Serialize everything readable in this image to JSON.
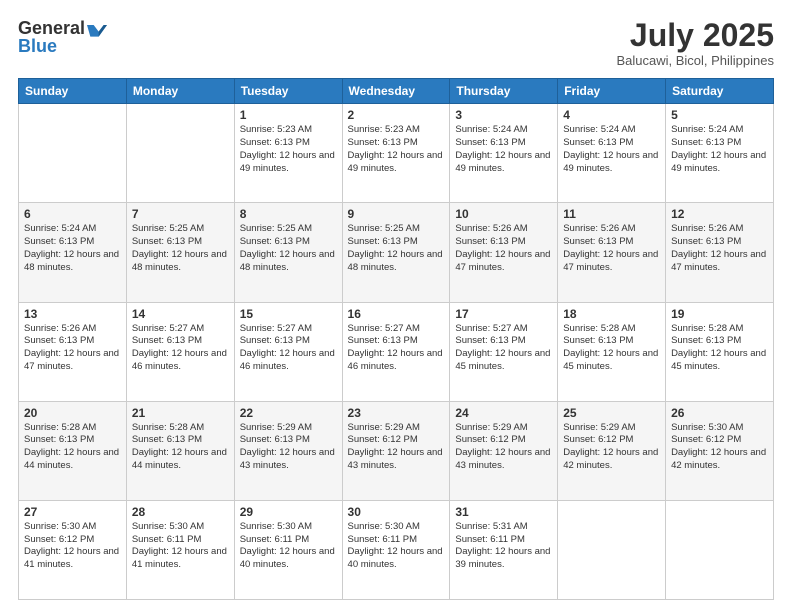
{
  "header": {
    "logo_general": "General",
    "logo_blue": "Blue",
    "month_title": "July 2025",
    "subtitle": "Balucawi, Bicol, Philippines"
  },
  "days_of_week": [
    "Sunday",
    "Monday",
    "Tuesday",
    "Wednesday",
    "Thursday",
    "Friday",
    "Saturday"
  ],
  "weeks": [
    [
      {
        "day": "",
        "info": ""
      },
      {
        "day": "",
        "info": ""
      },
      {
        "day": "1",
        "info": "Sunrise: 5:23 AM\nSunset: 6:13 PM\nDaylight: 12 hours and 49 minutes."
      },
      {
        "day": "2",
        "info": "Sunrise: 5:23 AM\nSunset: 6:13 PM\nDaylight: 12 hours and 49 minutes."
      },
      {
        "day": "3",
        "info": "Sunrise: 5:24 AM\nSunset: 6:13 PM\nDaylight: 12 hours and 49 minutes."
      },
      {
        "day": "4",
        "info": "Sunrise: 5:24 AM\nSunset: 6:13 PM\nDaylight: 12 hours and 49 minutes."
      },
      {
        "day": "5",
        "info": "Sunrise: 5:24 AM\nSunset: 6:13 PM\nDaylight: 12 hours and 49 minutes."
      }
    ],
    [
      {
        "day": "6",
        "info": "Sunrise: 5:24 AM\nSunset: 6:13 PM\nDaylight: 12 hours and 48 minutes."
      },
      {
        "day": "7",
        "info": "Sunrise: 5:25 AM\nSunset: 6:13 PM\nDaylight: 12 hours and 48 minutes."
      },
      {
        "day": "8",
        "info": "Sunrise: 5:25 AM\nSunset: 6:13 PM\nDaylight: 12 hours and 48 minutes."
      },
      {
        "day": "9",
        "info": "Sunrise: 5:25 AM\nSunset: 6:13 PM\nDaylight: 12 hours and 48 minutes."
      },
      {
        "day": "10",
        "info": "Sunrise: 5:26 AM\nSunset: 6:13 PM\nDaylight: 12 hours and 47 minutes."
      },
      {
        "day": "11",
        "info": "Sunrise: 5:26 AM\nSunset: 6:13 PM\nDaylight: 12 hours and 47 minutes."
      },
      {
        "day": "12",
        "info": "Sunrise: 5:26 AM\nSunset: 6:13 PM\nDaylight: 12 hours and 47 minutes."
      }
    ],
    [
      {
        "day": "13",
        "info": "Sunrise: 5:26 AM\nSunset: 6:13 PM\nDaylight: 12 hours and 47 minutes."
      },
      {
        "day": "14",
        "info": "Sunrise: 5:27 AM\nSunset: 6:13 PM\nDaylight: 12 hours and 46 minutes."
      },
      {
        "day": "15",
        "info": "Sunrise: 5:27 AM\nSunset: 6:13 PM\nDaylight: 12 hours and 46 minutes."
      },
      {
        "day": "16",
        "info": "Sunrise: 5:27 AM\nSunset: 6:13 PM\nDaylight: 12 hours and 46 minutes."
      },
      {
        "day": "17",
        "info": "Sunrise: 5:27 AM\nSunset: 6:13 PM\nDaylight: 12 hours and 45 minutes."
      },
      {
        "day": "18",
        "info": "Sunrise: 5:28 AM\nSunset: 6:13 PM\nDaylight: 12 hours and 45 minutes."
      },
      {
        "day": "19",
        "info": "Sunrise: 5:28 AM\nSunset: 6:13 PM\nDaylight: 12 hours and 45 minutes."
      }
    ],
    [
      {
        "day": "20",
        "info": "Sunrise: 5:28 AM\nSunset: 6:13 PM\nDaylight: 12 hours and 44 minutes."
      },
      {
        "day": "21",
        "info": "Sunrise: 5:28 AM\nSunset: 6:13 PM\nDaylight: 12 hours and 44 minutes."
      },
      {
        "day": "22",
        "info": "Sunrise: 5:29 AM\nSunset: 6:13 PM\nDaylight: 12 hours and 43 minutes."
      },
      {
        "day": "23",
        "info": "Sunrise: 5:29 AM\nSunset: 6:12 PM\nDaylight: 12 hours and 43 minutes."
      },
      {
        "day": "24",
        "info": "Sunrise: 5:29 AM\nSunset: 6:12 PM\nDaylight: 12 hours and 43 minutes."
      },
      {
        "day": "25",
        "info": "Sunrise: 5:29 AM\nSunset: 6:12 PM\nDaylight: 12 hours and 42 minutes."
      },
      {
        "day": "26",
        "info": "Sunrise: 5:30 AM\nSunset: 6:12 PM\nDaylight: 12 hours and 42 minutes."
      }
    ],
    [
      {
        "day": "27",
        "info": "Sunrise: 5:30 AM\nSunset: 6:12 PM\nDaylight: 12 hours and 41 minutes."
      },
      {
        "day": "28",
        "info": "Sunrise: 5:30 AM\nSunset: 6:11 PM\nDaylight: 12 hours and 41 minutes."
      },
      {
        "day": "29",
        "info": "Sunrise: 5:30 AM\nSunset: 6:11 PM\nDaylight: 12 hours and 40 minutes."
      },
      {
        "day": "30",
        "info": "Sunrise: 5:30 AM\nSunset: 6:11 PM\nDaylight: 12 hours and 40 minutes."
      },
      {
        "day": "31",
        "info": "Sunrise: 5:31 AM\nSunset: 6:11 PM\nDaylight: 12 hours and 39 minutes."
      },
      {
        "day": "",
        "info": ""
      },
      {
        "day": "",
        "info": ""
      }
    ]
  ]
}
